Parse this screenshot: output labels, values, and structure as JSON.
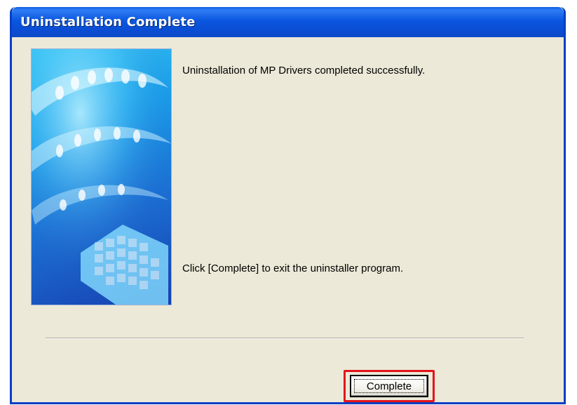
{
  "window": {
    "title": "Uninstallation Complete"
  },
  "content": {
    "message_primary": "Uninstallation of MP Drivers completed successfully.",
    "message_secondary": "Click [Complete] to exit the uninstaller program."
  },
  "footer": {
    "complete_button_label": "Complete"
  },
  "colors": {
    "titlebar": "#0a4fd6",
    "dialog_background": "#ece9d8",
    "highlight_border": "#e3141b"
  }
}
